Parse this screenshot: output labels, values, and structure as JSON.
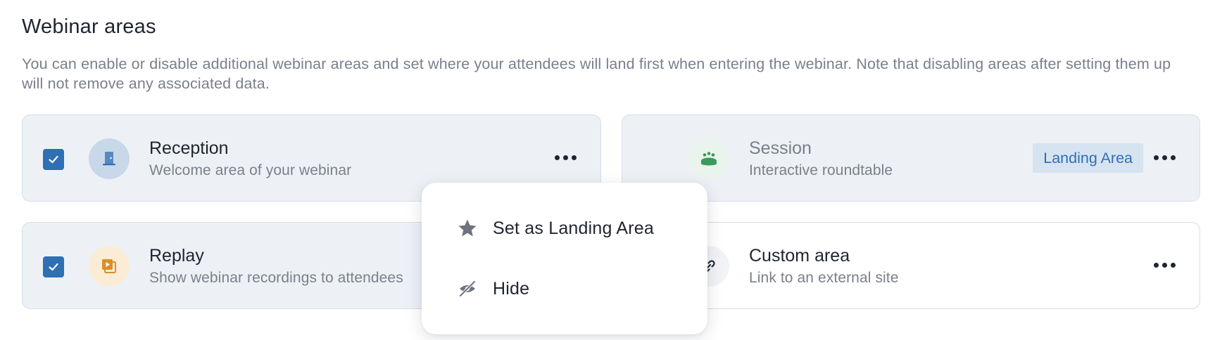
{
  "section": {
    "title": "Webinar areas",
    "description": "You can enable or disable additional webinar areas and set where your attendees will land first when entering the webinar. Note that disabling areas after setting them up will not remove any associated data."
  },
  "areas": [
    {
      "name": "Reception",
      "subtitle": "Welcome area of your webinar",
      "checked": true,
      "icon": "door-icon",
      "icon_color": "#2f6fb4"
    },
    {
      "name": "Session",
      "subtitle": "Interactive roundtable",
      "checked": false,
      "icon": "roundtable-icon",
      "icon_color": "#3a9a5b",
      "badge": "Landing Area"
    },
    {
      "name": "Replay",
      "subtitle": "Show webinar recordings to attendees",
      "checked": true,
      "icon": "replay-icon",
      "icon_color": "#d9902b"
    },
    {
      "name": "Custom area",
      "subtitle": "Link to an external site",
      "checked": false,
      "icon": "link-icon",
      "icon_color": "#1f2430"
    }
  ],
  "context_menu": {
    "items": [
      {
        "label": "Set as Landing Area",
        "icon": "star-icon"
      },
      {
        "label": "Hide",
        "icon": "eye-off-icon"
      }
    ]
  },
  "colors": {
    "accent": "#2f6fb4",
    "card_active_bg": "#edf1f6",
    "badge_bg": "#d6e3f1"
  }
}
